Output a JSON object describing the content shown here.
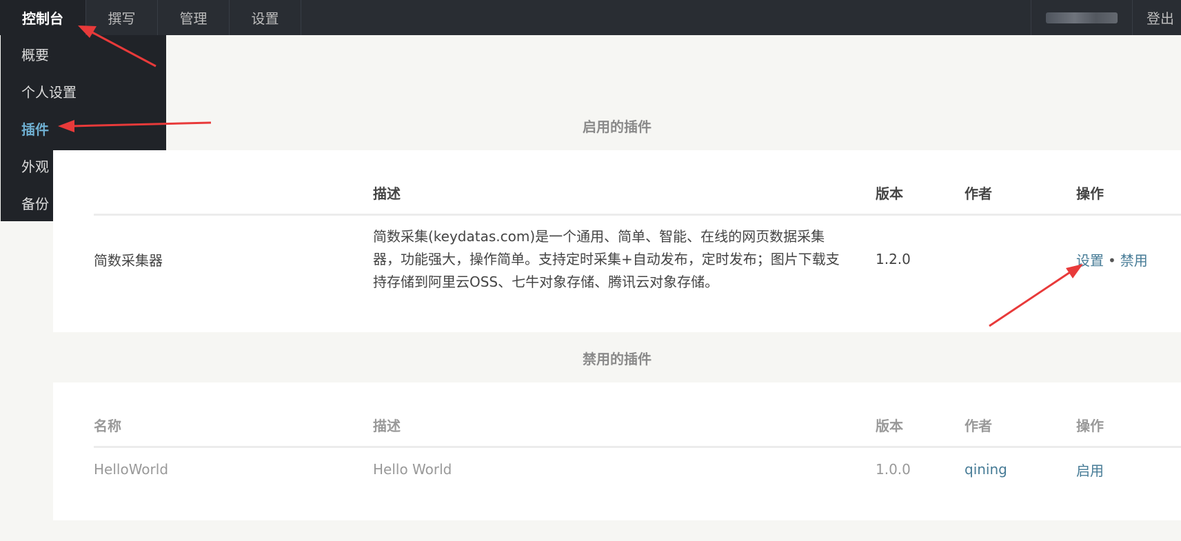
{
  "nav": {
    "tabs": [
      "控制台",
      "撰写",
      "管理",
      "设置"
    ],
    "logout": "登出"
  },
  "menu": {
    "items": [
      "概要",
      "个人设置",
      "插件",
      "外观",
      "备份"
    ]
  },
  "enabled": {
    "title": "启用的插件",
    "headers": [
      "描述",
      "版本",
      "作者",
      "操作"
    ],
    "rows": [
      {
        "name": "简数采集器",
        "description": "简数采集(keydatas.com)是一个通用、简单、智能、在线的网页数据采集器，功能强大，操作简单。支持定时采集+自动发布，定时发布；图片下载支持存储到阿里云OSS、七牛对象存储、腾讯云对象存储。",
        "version": "1.2.0",
        "author": "",
        "actions": [
          "设置",
          "禁用"
        ],
        "separator": "•"
      }
    ]
  },
  "disabled": {
    "title": "禁用的插件",
    "headers": [
      "名称",
      "描述",
      "版本",
      "作者",
      "操作"
    ],
    "rows": [
      {
        "name": "HelloWorld",
        "description": "Hello World",
        "version": "1.0.0",
        "author": "qining",
        "action": "启用"
      }
    ]
  },
  "colors": {
    "topbar": "#292d33",
    "menu": "#202328",
    "active_menu": "#6fb0d2",
    "link": "#467b96",
    "annotation": "#e83a3a"
  }
}
